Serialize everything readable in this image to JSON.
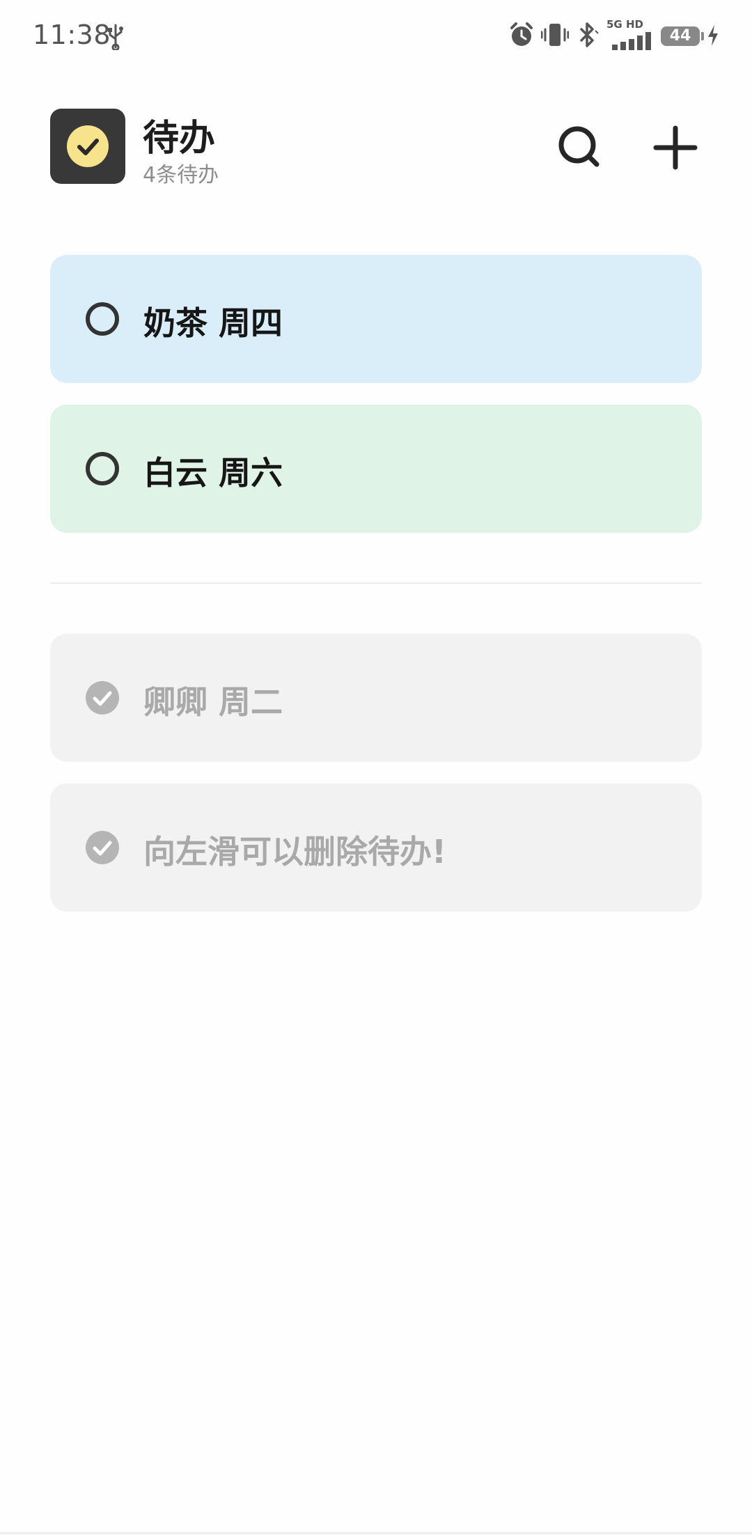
{
  "status_bar": {
    "time": "11:38",
    "network_label": "5G HD",
    "battery_level": "44",
    "icons": [
      "usb-icon",
      "alarm-icon",
      "vibrate-icon",
      "bluetooth-icon",
      "signal-icon",
      "battery-icon",
      "charging-icon"
    ]
  },
  "header": {
    "title": "待办",
    "subtitle": "4条待办",
    "logo_icon": "check-circle-icon",
    "search_icon": "search-icon",
    "add_icon": "plus-icon"
  },
  "todos": {
    "pending": [
      {
        "text": "奶茶 周四",
        "color": "#daeef9"
      },
      {
        "text": "白云 周六",
        "color": "#dff3e6"
      }
    ],
    "completed": [
      {
        "text": "卿卿 周二",
        "color": "#f2f2f2"
      },
      {
        "text": "向左滑可以删除待办!",
        "color": "#f2f2f2"
      }
    ]
  },
  "colors": {
    "logo_bg": "#383838",
    "logo_accent": "#f6e38b",
    "title_text": "#1d1d1d",
    "done_text": "#a9a9a9",
    "done_check": "#b5b5b5"
  }
}
